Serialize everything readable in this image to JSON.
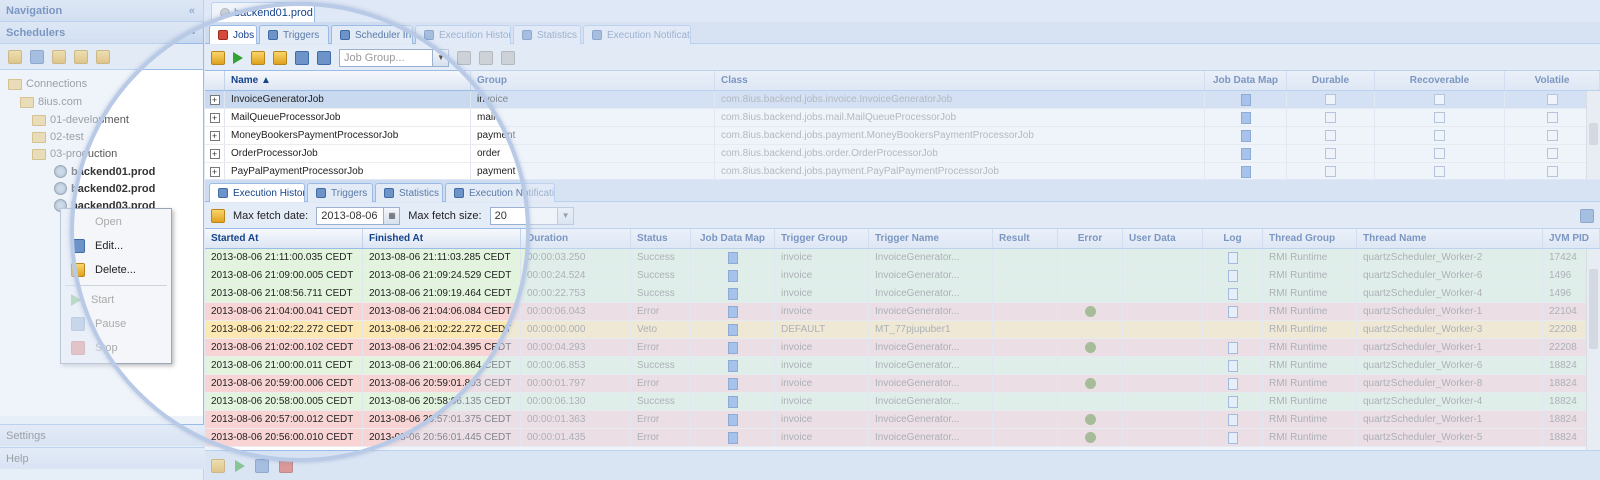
{
  "left": {
    "nav_title": "Navigation",
    "schedulers_title": "Schedulers",
    "tree": [
      {
        "label": "Connections",
        "icon": "folder-icon",
        "level": 0
      },
      {
        "label": "8ius.com",
        "icon": "folder-icon",
        "level": 1
      },
      {
        "label": "01-development",
        "icon": "folder-icon",
        "level": 2
      },
      {
        "label": "02-test",
        "icon": "folder-icon",
        "level": 2
      },
      {
        "label": "03-production",
        "icon": "folder-icon",
        "level": 2
      },
      {
        "label": "backend01.prod",
        "icon": "server-icon",
        "level": 3
      },
      {
        "label": "backend02.prod",
        "icon": "server-icon",
        "level": 3
      },
      {
        "label": "backend03.prod",
        "icon": "server-icon",
        "level": 3
      }
    ],
    "context_menu": {
      "open": "Open",
      "edit": "Edit...",
      "delete": "Delete...",
      "start": "Start",
      "pause": "Pause",
      "stop": "Stop"
    },
    "settings_label": "Settings",
    "help_label": "Help"
  },
  "doc_tab": "backend01.prod",
  "top_tabs": [
    "Jobs",
    "Triggers",
    "Scheduler Info",
    "Execution History",
    "Statistics",
    "Execution Notifications"
  ],
  "job_group_placeholder": "Job Group...",
  "jobs": {
    "headers": [
      "Name ▲",
      "Group",
      "Class",
      "Job Data Map",
      "Durable",
      "Recoverable",
      "Volatile"
    ],
    "rows": [
      {
        "name": "InvoiceGeneratorJob",
        "group": "invoice",
        "cls": "com.8ius.backend.jobs.invoice.InvoiceGeneratorJob"
      },
      {
        "name": "MailQueueProcessorJob",
        "group": "mail",
        "cls": "com.8ius.backend.jobs.mail.MailQueueProcessorJob"
      },
      {
        "name": "MoneyBookersPaymentProcessorJob",
        "group": "payment",
        "cls": "com.8ius.backend.jobs.payment.MoneyBookersPaymentProcessorJob"
      },
      {
        "name": "OrderProcessorJob",
        "group": "order",
        "cls": "com.8ius.backend.jobs.order.OrderProcessorJob"
      },
      {
        "name": "PayPalPaymentProcessorJob",
        "group": "payment",
        "cls": "com.8ius.backend.jobs.payment.PayPalPaymentProcessorJob"
      }
    ]
  },
  "bottom_tabs": [
    "Execution History",
    "Triggers",
    "Statistics",
    "Execution Notifications"
  ],
  "fetch": {
    "date_label": "Max fetch date:",
    "date_value": "2013-08-06",
    "size_label": "Max fetch size:",
    "size_value": "20"
  },
  "history": {
    "headers": [
      "Started At",
      "Finished At",
      "Duration",
      "Status",
      "Job Data Map",
      "Trigger Group",
      "Trigger Name",
      "Result",
      "Error",
      "User Data",
      "Log",
      "Thread Group",
      "Thread Name",
      "JVM PID"
    ],
    "rows": [
      {
        "start": "2013-08-06 21:11:00.035 CEDT",
        "end": "2013-08-06 21:11:03.285 CEDT",
        "dur": "00:00:03.250",
        "status": "Success",
        "tgroup": "invoice",
        "tname": "InvoiceGenerator...",
        "err": false,
        "log": true,
        "thgroup": "RMI Runtime",
        "thname": "quartzScheduler_Worker-2",
        "pid": "17424"
      },
      {
        "start": "2013-08-06 21:09:00.005 CEDT",
        "end": "2013-08-06 21:09:24.529 CEDT",
        "dur": "00:00:24.524",
        "status": "Success",
        "tgroup": "invoice",
        "tname": "InvoiceGenerator...",
        "err": false,
        "log": true,
        "thgroup": "RMI Runtime",
        "thname": "quartzScheduler_Worker-6",
        "pid": "1496"
      },
      {
        "start": "2013-08-06 21:08:56.711 CEDT",
        "end": "2013-08-06 21:09:19.464 CEDT",
        "dur": "00:00:22.753",
        "status": "Success",
        "tgroup": "invoice",
        "tname": "InvoiceGenerator...",
        "err": false,
        "log": true,
        "thgroup": "RMI Runtime",
        "thname": "quartzScheduler_Worker-4",
        "pid": "1496"
      },
      {
        "start": "2013-08-06 21:04:00.041 CEDT",
        "end": "2013-08-06 21:04:06.084 CEDT",
        "dur": "00:00:06.043",
        "status": "Error",
        "tgroup": "invoice",
        "tname": "InvoiceGenerator...",
        "err": true,
        "log": true,
        "thgroup": "RMI Runtime",
        "thname": "quartzScheduler_Worker-1",
        "pid": "22104"
      },
      {
        "start": "2013-08-06 21:02:22.272 CEDT",
        "end": "2013-08-06 21:02:22.272 CEDT",
        "dur": "00:00:00.000",
        "status": "Veto",
        "tgroup": "DEFAULT",
        "tname": "MT_77pjupuber1",
        "err": false,
        "log": false,
        "thgroup": "RMI Runtime",
        "thname": "quartzScheduler_Worker-3",
        "pid": "22208"
      },
      {
        "start": "2013-08-06 21:02:00.102 CEDT",
        "end": "2013-08-06 21:02:04.395 CEDT",
        "dur": "00:00:04.293",
        "status": "Error",
        "tgroup": "invoice",
        "tname": "InvoiceGenerator...",
        "err": true,
        "log": true,
        "thgroup": "RMI Runtime",
        "thname": "quartzScheduler_Worker-1",
        "pid": "22208"
      },
      {
        "start": "2013-08-06 21:00:00.011 CEDT",
        "end": "2013-08-06 21:00:06.864 CEDT",
        "dur": "00:00:06.853",
        "status": "Success",
        "tgroup": "invoice",
        "tname": "InvoiceGenerator...",
        "err": false,
        "log": true,
        "thgroup": "RMI Runtime",
        "thname": "quartzScheduler_Worker-6",
        "pid": "18824"
      },
      {
        "start": "2013-08-06 20:59:00.006 CEDT",
        "end": "2013-08-06 20:59:01.803 CEDT",
        "dur": "00:00:01.797",
        "status": "Error",
        "tgroup": "invoice",
        "tname": "InvoiceGenerator...",
        "err": true,
        "log": true,
        "thgroup": "RMI Runtime",
        "thname": "quartzScheduler_Worker-8",
        "pid": "18824"
      },
      {
        "start": "2013-08-06 20:58:00.005 CEDT",
        "end": "2013-08-06 20:58:06.135 CEDT",
        "dur": "00:00:06.130",
        "status": "Success",
        "tgroup": "invoice",
        "tname": "InvoiceGenerator...",
        "err": false,
        "log": true,
        "thgroup": "RMI Runtime",
        "thname": "quartzScheduler_Worker-4",
        "pid": "18824"
      },
      {
        "start": "2013-08-06 20:57:00.012 CEDT",
        "end": "2013-08-06 20:57:01.375 CEDT",
        "dur": "00:00:01.363",
        "status": "Error",
        "tgroup": "invoice",
        "tname": "InvoiceGenerator...",
        "err": true,
        "log": true,
        "thgroup": "RMI Runtime",
        "thname": "quartzScheduler_Worker-1",
        "pid": "18824"
      },
      {
        "start": "2013-08-06 20:56:00.010 CEDT",
        "end": "2013-08-06 20:56:01.445 CEDT",
        "dur": "00:00:01.435",
        "status": "Error",
        "tgroup": "invoice",
        "tname": "InvoiceGenerator...",
        "err": true,
        "log": true,
        "thgroup": "RMI Runtime",
        "thname": "quartzScheduler_Worker-5",
        "pid": "18824"
      }
    ]
  },
  "colors": {
    "success_row": "#e2f4dd",
    "error_row": "#f8d4d4",
    "veto_row": "#fde8b4",
    "header_text": "#15428b",
    "lens_ring": "#b8cae6"
  }
}
